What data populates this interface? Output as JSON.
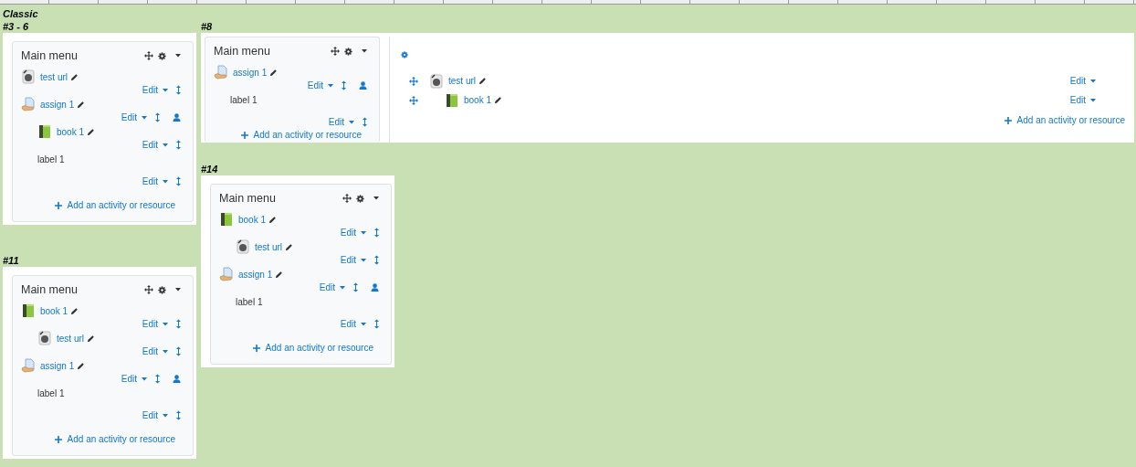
{
  "heading": "Classic",
  "columns": [
    [
      {
        "label": "#3 - 6",
        "block": {
          "title": "Main menu",
          "items": [
            {
              "kind": "url",
              "name": "test url",
              "edit": "Edit",
              "group_mode": false
            },
            {
              "kind": "assign",
              "name": "assign 1",
              "edit": "Edit",
              "group_mode": true,
              "children": [
                {
                  "kind": "book",
                  "name": "book 1",
                  "edit": "Edit",
                  "group_mode": false
                }
              ]
            },
            {
              "kind": "label",
              "name": "label 1",
              "edit": "Edit",
              "group_mode": false
            }
          ],
          "add": "Add an activity or resource"
        }
      },
      {
        "label": "#11",
        "block": {
          "title": "Main menu",
          "items": [
            {
              "kind": "book",
              "name": "book 1",
              "edit": "Edit",
              "group_mode": false,
              "children": [
                {
                  "kind": "url",
                  "name": "test url",
                  "edit": "Edit",
                  "group_mode": false
                }
              ]
            },
            {
              "kind": "assign",
              "name": "assign 1",
              "edit": "Edit",
              "group_mode": true
            },
            {
              "kind": "label",
              "name": "label 1",
              "edit": "Edit",
              "group_mode": false
            }
          ],
          "add": "Add an activity or resource"
        }
      }
    ],
    [
      {
        "label": "#8",
        "block": {
          "title": "Main menu",
          "items": [
            {
              "kind": "assign",
              "name": "assign 1",
              "edit": "Edit",
              "group_mode": true
            },
            {
              "kind": "label",
              "name": "label 1",
              "edit": "Edit",
              "group_mode": false
            }
          ],
          "add": "Add an activity or resource",
          "side": {
            "items": [
              {
                "kind": "url",
                "name": "test url",
                "edit": "Edit",
                "children": [
                  {
                    "kind": "book",
                    "name": "book 1",
                    "edit": "Edit"
                  }
                ]
              }
            ],
            "add": "Add an activity or resource"
          }
        }
      },
      {
        "label": "#14",
        "block": {
          "title": "Main menu",
          "items": [
            {
              "kind": "book",
              "name": "book 1",
              "edit": "Edit",
              "group_mode": false,
              "children": [
                {
                  "kind": "url",
                  "name": "test url",
                  "edit": "Edit",
                  "group_mode": false
                }
              ]
            },
            {
              "kind": "assign",
              "name": "assign 1",
              "edit": "Edit",
              "group_mode": true
            },
            {
              "kind": "label",
              "name": "label 1",
              "edit": "Edit",
              "group_mode": false
            }
          ],
          "add": "Add an activity or resource"
        }
      }
    ]
  ]
}
